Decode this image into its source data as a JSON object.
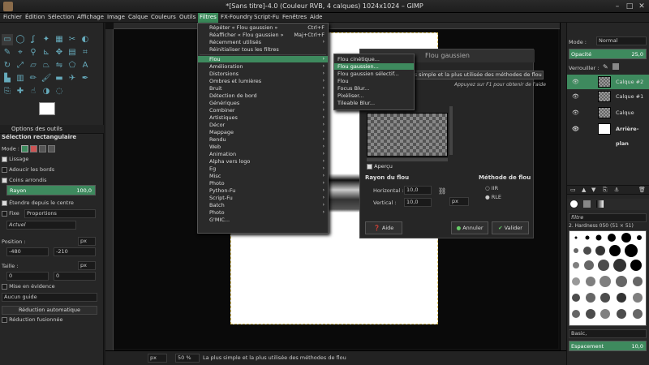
{
  "window": {
    "title": "*[Sans titre]-4.0 (Couleur RVB, 4 calques) 1024x1024 – GIMP"
  },
  "menubar": [
    "Fichier",
    "Édition",
    "Sélection",
    "Affichage",
    "Image",
    "Calque",
    "Couleurs",
    "Outils",
    "Filtres",
    "FX-Foundry",
    "Script-Fu",
    "Fenêtres",
    "Aide"
  ],
  "filters_menu": {
    "top": [
      {
        "label": "Répéter « Flou gaussien »",
        "shortcut": "Ctrl+F"
      },
      {
        "label": "Réafficher « Flou gaussien »",
        "shortcut": "Maj+Ctrl+F"
      },
      {
        "label": "Récemment utilisés",
        "shortcut": ""
      },
      {
        "label": "Réinitialiser tous les filtres",
        "shortcut": ""
      }
    ],
    "items": [
      "Flou",
      "Amélioration",
      "Distorsions",
      "Ombres et lumières",
      "Bruit",
      "Détection de bord",
      "Génériques",
      "Combiner",
      "Artistiques",
      "Décor",
      "Mappage",
      "Rendu",
      "Web",
      "Animation",
      "Alpha vers logo",
      "Eg",
      "Misc",
      "Photo",
      "Python-Fu",
      "Script-Fu",
      "Batch",
      "Photo",
      "G'MIC..."
    ]
  },
  "blur_submenu": [
    "Flou cinétique...",
    "Flou gaussien...",
    "Flou gaussien sélectif...",
    "Flou",
    "Focus Blur...",
    "Pixéliser...",
    "Tileable Blur..."
  ],
  "tooltip": {
    "text": "La plus simple et la plus utilisée des méthodes de flou",
    "hint": "Appuyez sur F1 pour obtenir de l'aide"
  },
  "dialog": {
    "title": "Flou gaussien",
    "preview_label": "Aperçu",
    "radius_heading": "Rayon du flou",
    "horizontal_label": "Horizontal :",
    "horizontal_value": "10,0",
    "vertical_label": "Vertical :",
    "vertical_value": "10,0",
    "unit": "px",
    "method_heading": "Méthode de flou",
    "method_iir": "IIR",
    "method_rle": "RLE",
    "help": "Aide",
    "cancel": "Annuler",
    "ok": "Valider"
  },
  "tool_options": {
    "tab": "Options des outils",
    "title": "Sélection rectangulaire",
    "mode_label": "Mode :",
    "lissage": "Lissage",
    "adoucir": "Adoucir les bords",
    "coins": "Coins arrondis",
    "rayon_label": "Rayon",
    "rayon_value": "100,0",
    "etendre": "Étendre depuis le centre",
    "fixe": "Fixe",
    "proportions": "Proportions",
    "actuel": "Actuel",
    "position_label": "Position :",
    "pos_unit": "px",
    "pos_x": "-480",
    "pos_y": "-210",
    "taille_label": "Taille :",
    "size_unit": "px",
    "size_w": "0",
    "size_h": "0",
    "mise": "Mise en évidence",
    "guide": "Aucun guide",
    "auto": "Réduction automatique",
    "fusion": "Réduction fusionnée"
  },
  "layers_panel": {
    "mode_label": "Mode :",
    "mode_value": "Normal",
    "opacity_label": "Opacité",
    "opacity_value": "25,0",
    "lock_label": "Verrouiller :",
    "layers": [
      "Calque #2",
      "Calque #1",
      "Calque",
      "Arrière-plan"
    ]
  },
  "brushes_panel": {
    "filter": "filtre",
    "brush_name": "2. Hardness 050 (51 × 51)",
    "preset": "Basic,",
    "spacing_label": "Espacement",
    "spacing_value": "10,0"
  },
  "statusbar": {
    "unit": "px",
    "zoom": "50 %",
    "message": "La plus simple et la plus utilisée des méthodes de flou"
  }
}
